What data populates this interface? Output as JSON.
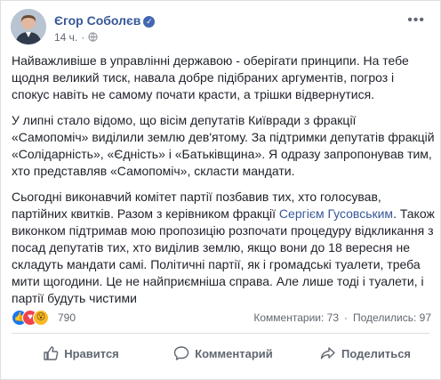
{
  "post": {
    "author": "Єгор Соболєв",
    "time": "14 ч.",
    "paragraphs": [
      [
        "Найважливіше в управлінні державою - оберігати принципи. На тебе",
        "щодня великий тиск, навала добре підібраних аргументів, погроз і",
        "спокус навіть не самому почати красти, а трішки відвернутися."
      ],
      [
        "У липні стало відомо, що вісім депутатів Київради з фракції",
        "«Самопоміч» виділили землю дев'ятому. За підтримки депутатів фракцій",
        "«Солідарність», «Єдність» і «Батьківщина». Я одразу запропонував тим,",
        "хто представляв «Самопоміч», скласти мандати."
      ]
    ],
    "p3": {
      "l1": "Сьогодні виконавчий комітет партії позбавив тих, хто голосував,",
      "l2_before": "партійних квитків. Разом з керівником фракції ",
      "l2_link": "Сергієм Гусовським",
      "l2_after": ". Також",
      "l3": "виконком підтримав мою пропозицію розпочати процедуру відкликання з",
      "l4": "посад депутатів тих, хто виділив землю, якщо вони до 18 вересня не",
      "l5": "складуть мандати самі. Політичні партії, як і громадські туалети, треба",
      "l6": "мити щогодини. Це не найприємніша справа. Але лише тоді і туалети, і",
      "l7": "партії будуть чистими"
    },
    "reactions_count": "790",
    "comments": "Комментарии: 73",
    "shares": "Поделились: 97",
    "actions": {
      "like": "Нравится",
      "comment": "Комментарий",
      "share": "Поделиться"
    }
  }
}
